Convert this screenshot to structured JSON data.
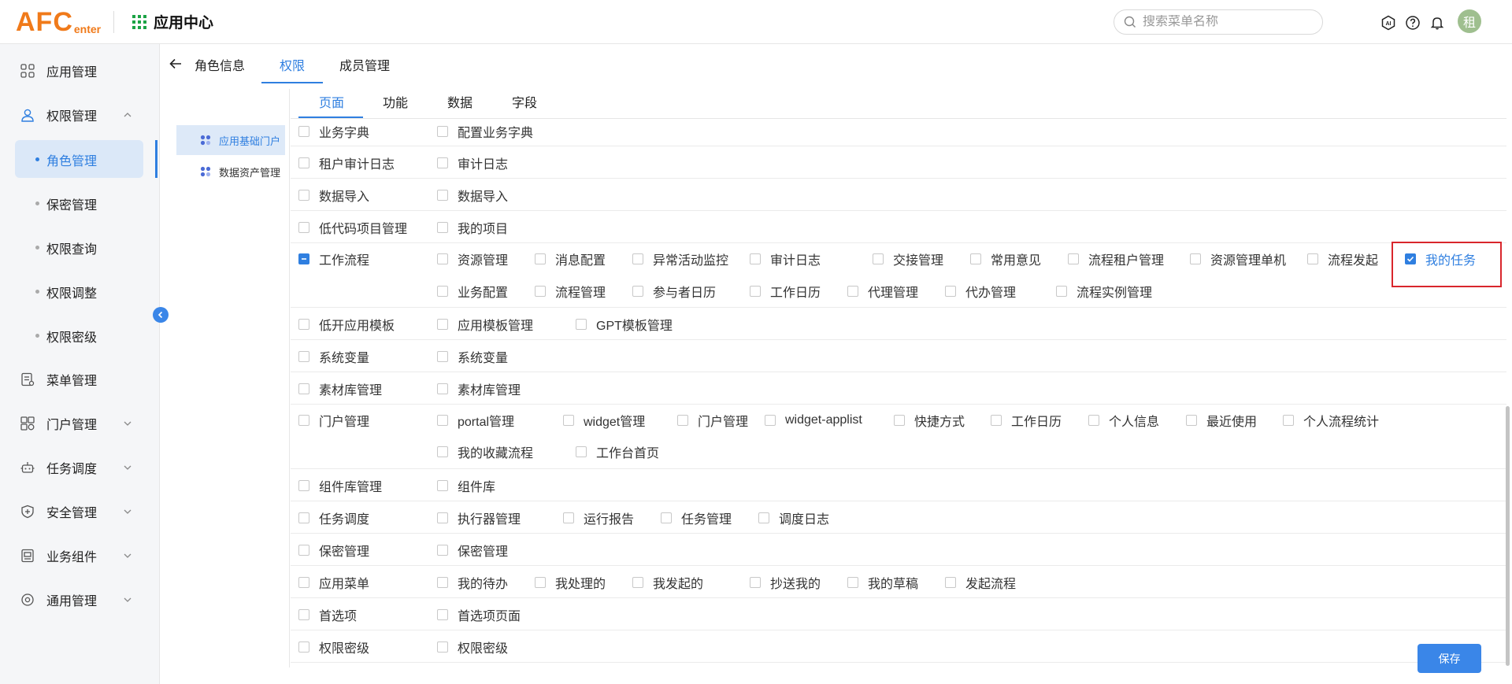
{
  "header": {
    "logo_big": "AFC",
    "logo_small": "enter",
    "app_center_label": "应用中心",
    "search_placeholder": "搜索菜单名称",
    "avatar_text": "租"
  },
  "sidebar": {
    "items": [
      {
        "label": "应用管理",
        "icon": "apps-icon"
      },
      {
        "label": "权限管理",
        "icon": "user-icon",
        "expanded": true
      },
      {
        "label": "菜单管理",
        "icon": "document-icon"
      },
      {
        "label": "门户管理",
        "icon": "portal-icon"
      },
      {
        "label": "任务调度",
        "icon": "robot-icon"
      },
      {
        "label": "安全管理",
        "icon": "shield-icon"
      },
      {
        "label": "业务组件",
        "icon": "component-icon"
      },
      {
        "label": "通用管理",
        "icon": "settings-icon"
      }
    ],
    "sub_items": [
      "角色管理",
      "保密管理",
      "权限查询",
      "权限调整",
      "权限密级"
    ]
  },
  "top_tabs": [
    "角色信息",
    "权限",
    "成员管理"
  ],
  "tree": [
    "应用基础门户",
    "数据资产管理"
  ],
  "sub_tabs": [
    "页面",
    "功能",
    "数据",
    "字段"
  ],
  "rows": [
    {
      "label": "业务字典",
      "items": [
        "配置业务字典"
      ]
    },
    {
      "label": "租户审计日志",
      "items": [
        "审计日志"
      ]
    },
    {
      "label": "数据导入",
      "items": [
        "数据导入"
      ]
    },
    {
      "label": "低代码项目管理",
      "items": [
        "我的项目"
      ]
    },
    {
      "label": "工作流程",
      "items": [
        "资源管理",
        "消息配置",
        "异常活动监控",
        "审计日志",
        "交接管理",
        "常用意见",
        "流程租户管理",
        "资源管理单机",
        "流程发起",
        "我的任务",
        "业务配置",
        "流程管理",
        "参与者日历",
        "工作日历",
        "代理管理",
        "代办管理",
        "流程实例管理"
      ]
    },
    {
      "label": "低开应用模板",
      "items": [
        "应用模板管理",
        "GPT模板管理"
      ]
    },
    {
      "label": "系统变量",
      "items": [
        "系统变量"
      ]
    },
    {
      "label": "素材库管理",
      "items": [
        "素材库管理"
      ]
    },
    {
      "label": "门户管理",
      "items": [
        "portal管理",
        "widget管理",
        "门户管理",
        "widget-applist",
        "快捷方式",
        "工作日历",
        "个人信息",
        "最近使用",
        "个人流程统计",
        "我的收藏流程",
        "工作台首页"
      ]
    },
    {
      "label": "组件库管理",
      "items": [
        "组件库"
      ]
    },
    {
      "label": "任务调度",
      "items": [
        "执行器管理",
        "运行报告",
        "任务管理",
        "调度日志"
      ]
    },
    {
      "label": "保密管理",
      "items": [
        "保密管理"
      ]
    },
    {
      "label": "应用菜单",
      "items": [
        "我的待办",
        "我处理的",
        "我发起的",
        "抄送我的",
        "我的草稿",
        "发起流程"
      ]
    },
    {
      "label": "首选项",
      "items": [
        "首选项页面"
      ]
    },
    {
      "label": "权限密级",
      "items": [
        "权限密级"
      ]
    }
  ],
  "save_label": "保存",
  "colors": {
    "accent": "#2f7fe0",
    "logo": "#f07a1a",
    "highlight": "#d9262c"
  }
}
